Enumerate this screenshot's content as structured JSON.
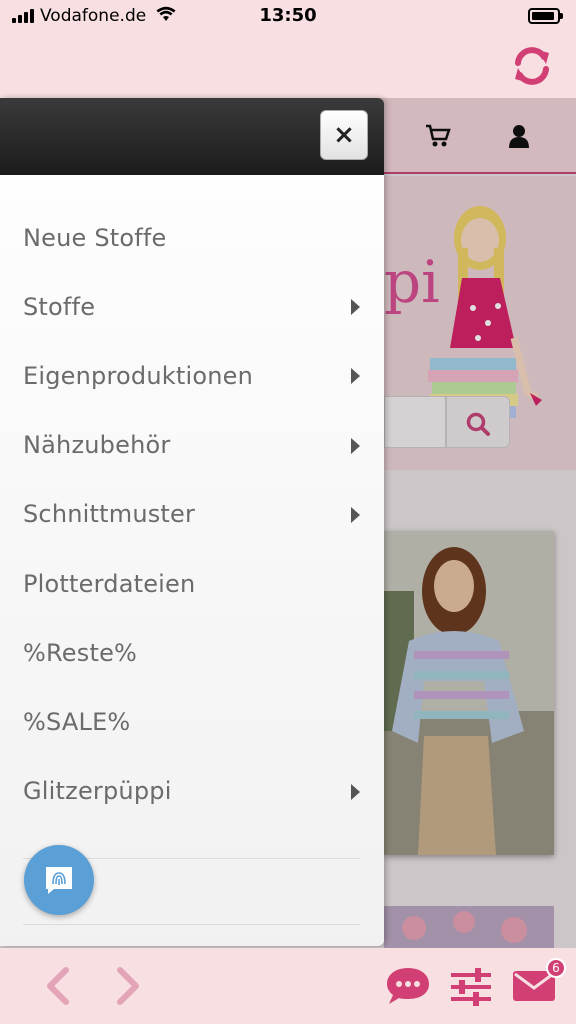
{
  "status_bar": {
    "carrier": "Vodafone.de",
    "time": "13:50"
  },
  "colors": {
    "accent": "#d23f75",
    "menu_text": "#6b6b6b",
    "fingerprint_badge": "#5a9fd6"
  },
  "menu": {
    "close_label": "×",
    "items": [
      {
        "label": "Neue Stoffe",
        "has_submenu": false
      },
      {
        "label": "Stoffe",
        "has_submenu": true
      },
      {
        "label": "Eigenproduktionen",
        "has_submenu": true
      },
      {
        "label": "Nähzubehör",
        "has_submenu": true
      },
      {
        "label": "Schnittmuster",
        "has_submenu": true
      },
      {
        "label": "Plotterdateien",
        "has_submenu": false
      },
      {
        "label": "%Reste%",
        "has_submenu": false
      },
      {
        "label": "%SALE%",
        "has_submenu": false
      },
      {
        "label": "Glitzerpüppi",
        "has_submenu": true
      }
    ]
  },
  "page": {
    "logo_fragment": "pi"
  },
  "toolbar": {
    "icons": [
      "back-icon",
      "forward-icon",
      "chat-icon",
      "filter-icon",
      "mail-icon"
    ],
    "mail_badge": "6"
  }
}
